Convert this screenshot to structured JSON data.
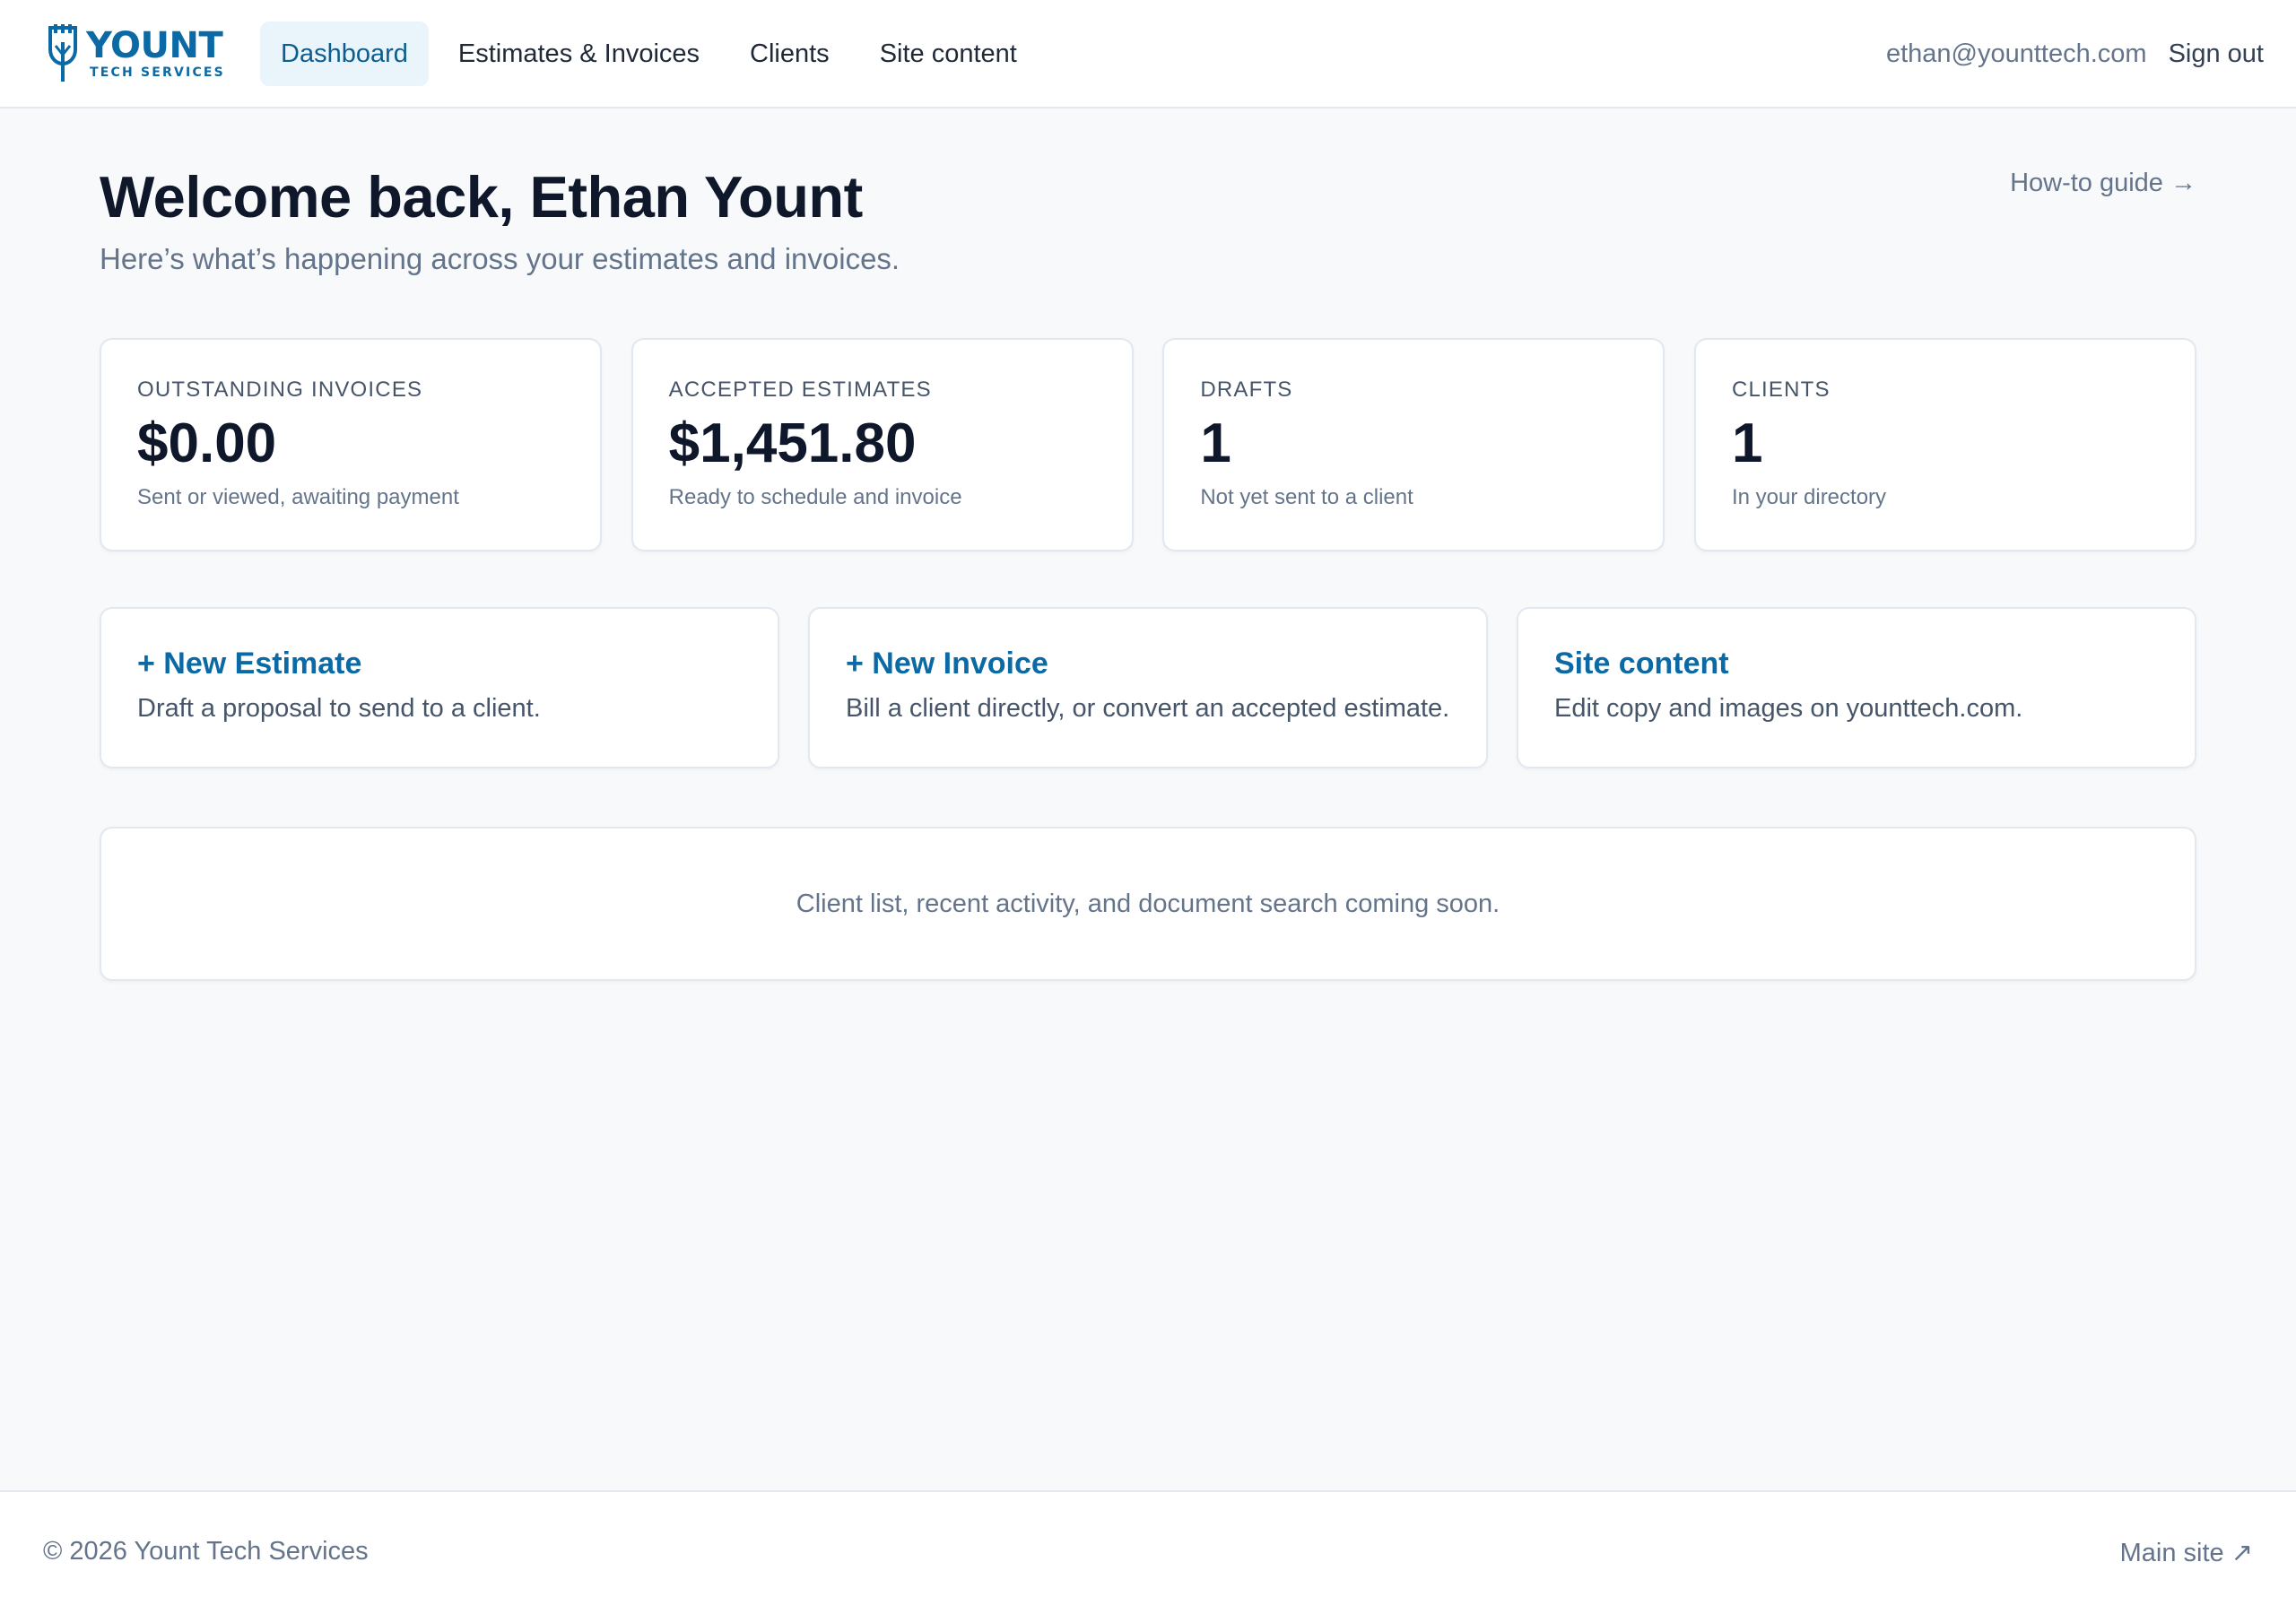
{
  "brand": {
    "name": "YOUNT",
    "tagline": "TECH SERVICES",
    "color": "#0b6aa5"
  },
  "nav": {
    "items": [
      {
        "label": "Dashboard",
        "active": true
      },
      {
        "label": "Estimates & Invoices",
        "active": false
      },
      {
        "label": "Clients",
        "active": false
      },
      {
        "label": "Site content",
        "active": false
      }
    ]
  },
  "user": {
    "email": "ethan@younttech.com",
    "sign_out_label": "Sign out"
  },
  "page": {
    "title": "Welcome back, Ethan Yount",
    "subtitle": "Here’s what’s happening across your estimates and invoices.",
    "guide_link": "How-to guide →"
  },
  "stats": [
    {
      "label": "OUTSTANDING INVOICES",
      "value": "$0.00",
      "note": "Sent or viewed, awaiting payment"
    },
    {
      "label": "ACCEPTED ESTIMATES",
      "value": "$1,451.80",
      "note": "Ready to schedule and invoice"
    },
    {
      "label": "DRAFTS",
      "value": "1",
      "note": "Not yet sent to a client"
    },
    {
      "label": "CLIENTS",
      "value": "1",
      "note": "In your directory"
    }
  ],
  "actions": [
    {
      "title": "+ New Estimate",
      "description": "Draft a proposal to send to a client."
    },
    {
      "title": "+ New Invoice",
      "description": "Bill a client directly, or convert an accepted estimate."
    },
    {
      "title": "Site content",
      "description": "Edit copy and images on younttech.com."
    }
  ],
  "placeholder": {
    "text": "Client list, recent activity, and document search coming soon."
  },
  "footer": {
    "copyright": "© 2026 Yount Tech Services",
    "main_site_link": "Main site ↗"
  }
}
